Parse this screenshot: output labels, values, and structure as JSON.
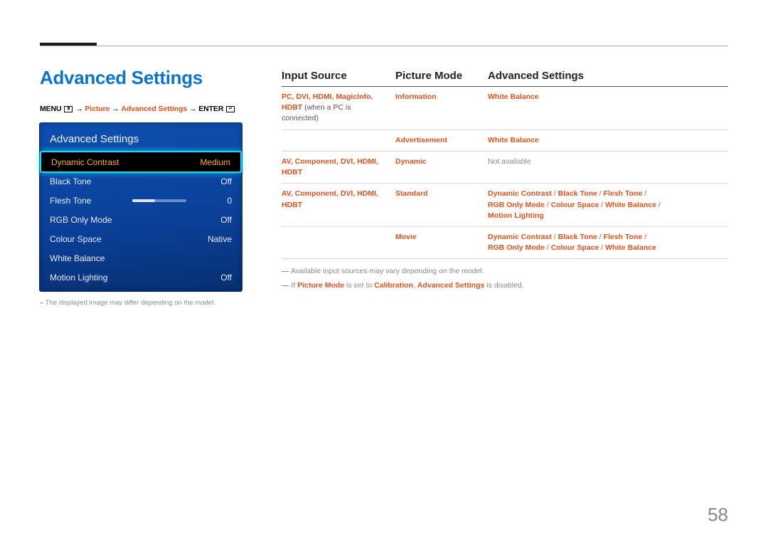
{
  "section_title": "Advanced Settings",
  "breadcrumb": {
    "menu": "MENU",
    "p1": "Picture",
    "p2": "Advanced Settings",
    "enter": "ENTER"
  },
  "panel": {
    "title": "Advanced Settings",
    "rows": [
      {
        "label": "Dynamic Contrast",
        "value": "Medium",
        "selected": true
      },
      {
        "label": "Black Tone",
        "value": "Off"
      },
      {
        "label": "Flesh Tone",
        "value": "0",
        "slider": true
      },
      {
        "label": "RGB Only Mode",
        "value": "Off"
      },
      {
        "label": "Colour Space",
        "value": "Native"
      },
      {
        "label": "White Balance",
        "value": ""
      },
      {
        "label": "Motion Lighting",
        "value": "Off"
      }
    ]
  },
  "panel_footnote": "The displayed image may differ depending on the model.",
  "table": {
    "headers": [
      "Input Source",
      "Picture Mode",
      "Advanced Settings"
    ],
    "rows": [
      {
        "src_hl": "PC, DVI, HDMI, MagicInfo, HDBT",
        "src_plain": " (when a PC is connected)",
        "mode": "Information",
        "adv": [
          [
            "White Balance"
          ]
        ]
      },
      {
        "src_hl": "",
        "src_plain": "",
        "mode": "Advertisement",
        "adv": [
          [
            "White Balance"
          ]
        ]
      },
      {
        "src_hl": "AV, Component, DVI, HDMI, HDBT",
        "src_plain": "",
        "mode": "Dynamic",
        "adv_plain": "Not available"
      },
      {
        "src_hl": "AV, Component, DVI, HDMI, HDBT",
        "src_plain": "",
        "mode": "Standard",
        "adv": [
          [
            "Dynamic Contrast",
            "Black Tone",
            "Flesh Tone"
          ],
          [
            "RGB Only Mode",
            "Colour Space",
            "White Balance"
          ],
          [
            "Motion Lighting"
          ]
        ]
      },
      {
        "src_hl": "",
        "src_plain": "",
        "mode": "Movie",
        "adv": [
          [
            "Dynamic Contrast",
            "Black Tone",
            "Flesh Tone"
          ],
          [
            "RGB Only Mode",
            "Colour Space",
            "White Balance"
          ]
        ]
      }
    ]
  },
  "notes": {
    "n1": "Available input sources may vary depending on the model.",
    "n2_a": "If ",
    "n2_b": "Picture Mode",
    "n2_c": " is set to ",
    "n2_d": "Calibration",
    "n2_e": ", ",
    "n2_f": "Advanced Settings",
    "n2_g": " is disabled."
  },
  "page_number": "58"
}
